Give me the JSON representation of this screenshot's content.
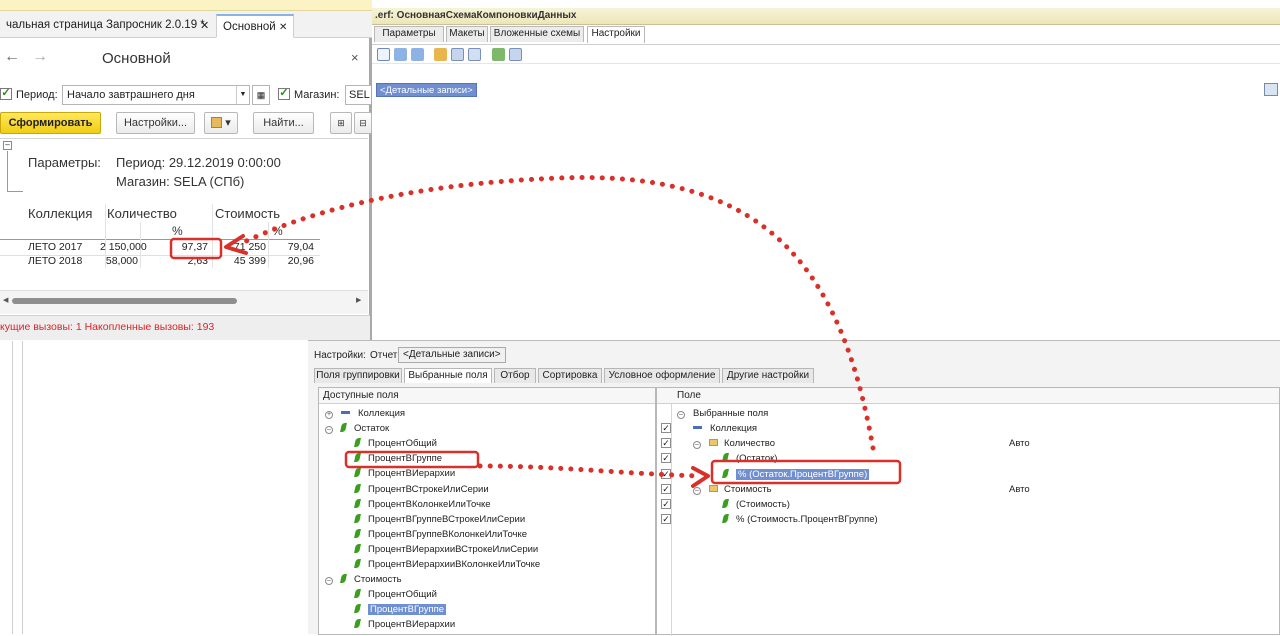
{
  "designer": {
    "title": ".erf: ОсновнаяСхемаКомпоновкиДанных",
    "tabs": [
      "Параметры",
      "Макеты",
      "Вложенные схемы",
      "Настройки"
    ],
    "active_tab": "Настройки",
    "detail_records": "<Детальные записи>"
  },
  "settings": {
    "label": "Настройки:",
    "report_label": "Отчет",
    "report_value": "<Детальные записи>",
    "tabs": [
      "Поля группировки",
      "Выбранные поля",
      "Отбор",
      "Сортировка",
      "Условное оформление",
      "Другие настройки"
    ],
    "active_tab": "Выбранные поля",
    "available_header": "Доступные поля",
    "available": [
      {
        "label": "Коллекция",
        "kind": "field",
        "level": 0
      },
      {
        "label": "Остаток",
        "kind": "group",
        "level": 0
      },
      {
        "label": "ПроцентОбщий",
        "kind": "leaf",
        "level": 1
      },
      {
        "label": "ПроцентВГруппе",
        "kind": "leaf",
        "level": 1
      },
      {
        "label": "ПроцентВИерархии",
        "kind": "leaf",
        "level": 1
      },
      {
        "label": "ПроцентВСтрокеИлиСерии",
        "kind": "leaf",
        "level": 1
      },
      {
        "label": "ПроцентВКолонкеИлиТочке",
        "kind": "leaf",
        "level": 1
      },
      {
        "label": "ПроцентВГруппеВСтрокеИлиСерии",
        "kind": "leaf",
        "level": 1
      },
      {
        "label": "ПроцентВГруппеВКолонкеИлиТочке",
        "kind": "leaf",
        "level": 1
      },
      {
        "label": "ПроцентВИерархииВСтрокеИлиСерии",
        "kind": "leaf",
        "level": 1
      },
      {
        "label": "ПроцентВИерархииВКолонкеИлиТочке",
        "kind": "leaf",
        "level": 1
      },
      {
        "label": "Стоимость",
        "kind": "group",
        "level": 0
      },
      {
        "label": "ПроцентОбщий",
        "kind": "leaf",
        "level": 1
      },
      {
        "label": "ПроцентВГруппе",
        "kind": "leaf",
        "level": 1,
        "selected": true
      },
      {
        "label": "ПроцентВИерархии",
        "kind": "leaf",
        "level": 1
      }
    ],
    "selected_header": "Поле",
    "selected_root": "Выбранные поля",
    "selected": [
      {
        "label": "Коллекция",
        "kind": "field",
        "level": 1,
        "mode": ""
      },
      {
        "label": "Количество",
        "kind": "folder",
        "level": 1,
        "mode": "Авто"
      },
      {
        "label": "(Остаток)",
        "kind": "leaf",
        "level": 2,
        "mode": ""
      },
      {
        "label": "% (Остаток.ПроцентВГруппе)",
        "kind": "leaf",
        "level": 2,
        "mode": "",
        "selected": true
      },
      {
        "label": "Стоимость",
        "kind": "folder",
        "level": 1,
        "mode": "Авто"
      },
      {
        "label": "(Стоимость)",
        "kind": "leaf",
        "level": 2,
        "mode": ""
      },
      {
        "label": "% (Стоимость.ПроцентВГруппе)",
        "kind": "leaf",
        "level": 2,
        "mode": ""
      }
    ]
  },
  "report": {
    "tabs": [
      "чальная страница",
      "Запросник 2.0.19 *",
      "Основной"
    ],
    "title": "Основной",
    "period_label": "Период:",
    "period_value": "Начало завтрашнего дня",
    "store_label": "Магазин:",
    "store_value": "SEL",
    "generate_label": "Сформировать",
    "settings_label": "Настройки...",
    "find_label": "Найти...",
    "params_label": "Параметры:",
    "params_line1": "Период: 29.12.2019 0:00:00",
    "params_line2": "Магазин: SELA (СПб)",
    "col_collection": "Коллекция",
    "col_quantity": "Количество",
    "col_cost": "Стоимость",
    "pct": "%",
    "rows": [
      {
        "name": "ЛЕТО 2017",
        "qty": "2 150,000",
        "qty_pct": "97,37",
        "cost": "71 250",
        "cost_pct": "79,04"
      },
      {
        "name": "ЛЕТО 2018",
        "qty": "58,000",
        "qty_pct": "2,63",
        "cost": "45 399",
        "cost_pct": "20,96"
      }
    ],
    "status": "кущие вызовы: 1   Накопленные вызовы: 193"
  },
  "colors": {
    "accent": "#6f8fd1",
    "highlight": "#d9302a",
    "button": "#f0cd15"
  }
}
